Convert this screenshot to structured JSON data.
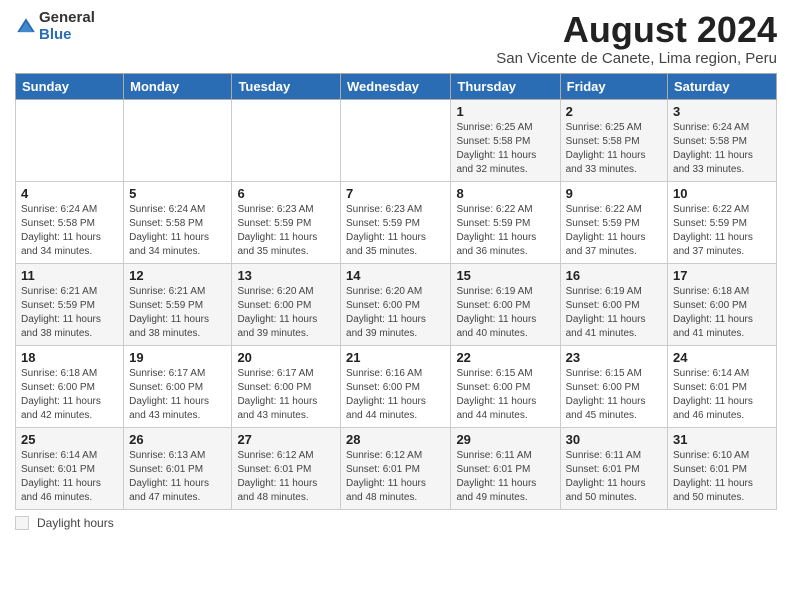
{
  "logo": {
    "general": "General",
    "blue": "Blue"
  },
  "header": {
    "title": "August 2024",
    "subtitle": "San Vicente de Canete, Lima region, Peru"
  },
  "days_header": [
    "Sunday",
    "Monday",
    "Tuesday",
    "Wednesday",
    "Thursday",
    "Friday",
    "Saturday"
  ],
  "weeks": [
    [
      {
        "num": "",
        "info": ""
      },
      {
        "num": "",
        "info": ""
      },
      {
        "num": "",
        "info": ""
      },
      {
        "num": "",
        "info": ""
      },
      {
        "num": "1",
        "info": "Sunrise: 6:25 AM\nSunset: 5:58 PM\nDaylight: 11 hours\nand 32 minutes."
      },
      {
        "num": "2",
        "info": "Sunrise: 6:25 AM\nSunset: 5:58 PM\nDaylight: 11 hours\nand 33 minutes."
      },
      {
        "num": "3",
        "info": "Sunrise: 6:24 AM\nSunset: 5:58 PM\nDaylight: 11 hours\nand 33 minutes."
      }
    ],
    [
      {
        "num": "4",
        "info": "Sunrise: 6:24 AM\nSunset: 5:58 PM\nDaylight: 11 hours\nand 34 minutes."
      },
      {
        "num": "5",
        "info": "Sunrise: 6:24 AM\nSunset: 5:58 PM\nDaylight: 11 hours\nand 34 minutes."
      },
      {
        "num": "6",
        "info": "Sunrise: 6:23 AM\nSunset: 5:59 PM\nDaylight: 11 hours\nand 35 minutes."
      },
      {
        "num": "7",
        "info": "Sunrise: 6:23 AM\nSunset: 5:59 PM\nDaylight: 11 hours\nand 35 minutes."
      },
      {
        "num": "8",
        "info": "Sunrise: 6:22 AM\nSunset: 5:59 PM\nDaylight: 11 hours\nand 36 minutes."
      },
      {
        "num": "9",
        "info": "Sunrise: 6:22 AM\nSunset: 5:59 PM\nDaylight: 11 hours\nand 37 minutes."
      },
      {
        "num": "10",
        "info": "Sunrise: 6:22 AM\nSunset: 5:59 PM\nDaylight: 11 hours\nand 37 minutes."
      }
    ],
    [
      {
        "num": "11",
        "info": "Sunrise: 6:21 AM\nSunset: 5:59 PM\nDaylight: 11 hours\nand 38 minutes."
      },
      {
        "num": "12",
        "info": "Sunrise: 6:21 AM\nSunset: 5:59 PM\nDaylight: 11 hours\nand 38 minutes."
      },
      {
        "num": "13",
        "info": "Sunrise: 6:20 AM\nSunset: 6:00 PM\nDaylight: 11 hours\nand 39 minutes."
      },
      {
        "num": "14",
        "info": "Sunrise: 6:20 AM\nSunset: 6:00 PM\nDaylight: 11 hours\nand 39 minutes."
      },
      {
        "num": "15",
        "info": "Sunrise: 6:19 AM\nSunset: 6:00 PM\nDaylight: 11 hours\nand 40 minutes."
      },
      {
        "num": "16",
        "info": "Sunrise: 6:19 AM\nSunset: 6:00 PM\nDaylight: 11 hours\nand 41 minutes."
      },
      {
        "num": "17",
        "info": "Sunrise: 6:18 AM\nSunset: 6:00 PM\nDaylight: 11 hours\nand 41 minutes."
      }
    ],
    [
      {
        "num": "18",
        "info": "Sunrise: 6:18 AM\nSunset: 6:00 PM\nDaylight: 11 hours\nand 42 minutes."
      },
      {
        "num": "19",
        "info": "Sunrise: 6:17 AM\nSunset: 6:00 PM\nDaylight: 11 hours\nand 43 minutes."
      },
      {
        "num": "20",
        "info": "Sunrise: 6:17 AM\nSunset: 6:00 PM\nDaylight: 11 hours\nand 43 minutes."
      },
      {
        "num": "21",
        "info": "Sunrise: 6:16 AM\nSunset: 6:00 PM\nDaylight: 11 hours\nand 44 minutes."
      },
      {
        "num": "22",
        "info": "Sunrise: 6:15 AM\nSunset: 6:00 PM\nDaylight: 11 hours\nand 44 minutes."
      },
      {
        "num": "23",
        "info": "Sunrise: 6:15 AM\nSunset: 6:00 PM\nDaylight: 11 hours\nand 45 minutes."
      },
      {
        "num": "24",
        "info": "Sunrise: 6:14 AM\nSunset: 6:01 PM\nDaylight: 11 hours\nand 46 minutes."
      }
    ],
    [
      {
        "num": "25",
        "info": "Sunrise: 6:14 AM\nSunset: 6:01 PM\nDaylight: 11 hours\nand 46 minutes."
      },
      {
        "num": "26",
        "info": "Sunrise: 6:13 AM\nSunset: 6:01 PM\nDaylight: 11 hours\nand 47 minutes."
      },
      {
        "num": "27",
        "info": "Sunrise: 6:12 AM\nSunset: 6:01 PM\nDaylight: 11 hours\nand 48 minutes."
      },
      {
        "num": "28",
        "info": "Sunrise: 6:12 AM\nSunset: 6:01 PM\nDaylight: 11 hours\nand 48 minutes."
      },
      {
        "num": "29",
        "info": "Sunrise: 6:11 AM\nSunset: 6:01 PM\nDaylight: 11 hours\nand 49 minutes."
      },
      {
        "num": "30",
        "info": "Sunrise: 6:11 AM\nSunset: 6:01 PM\nDaylight: 11 hours\nand 50 minutes."
      },
      {
        "num": "31",
        "info": "Sunrise: 6:10 AM\nSunset: 6:01 PM\nDaylight: 11 hours\nand 50 minutes."
      }
    ]
  ],
  "legend": {
    "label": "Daylight hours"
  }
}
